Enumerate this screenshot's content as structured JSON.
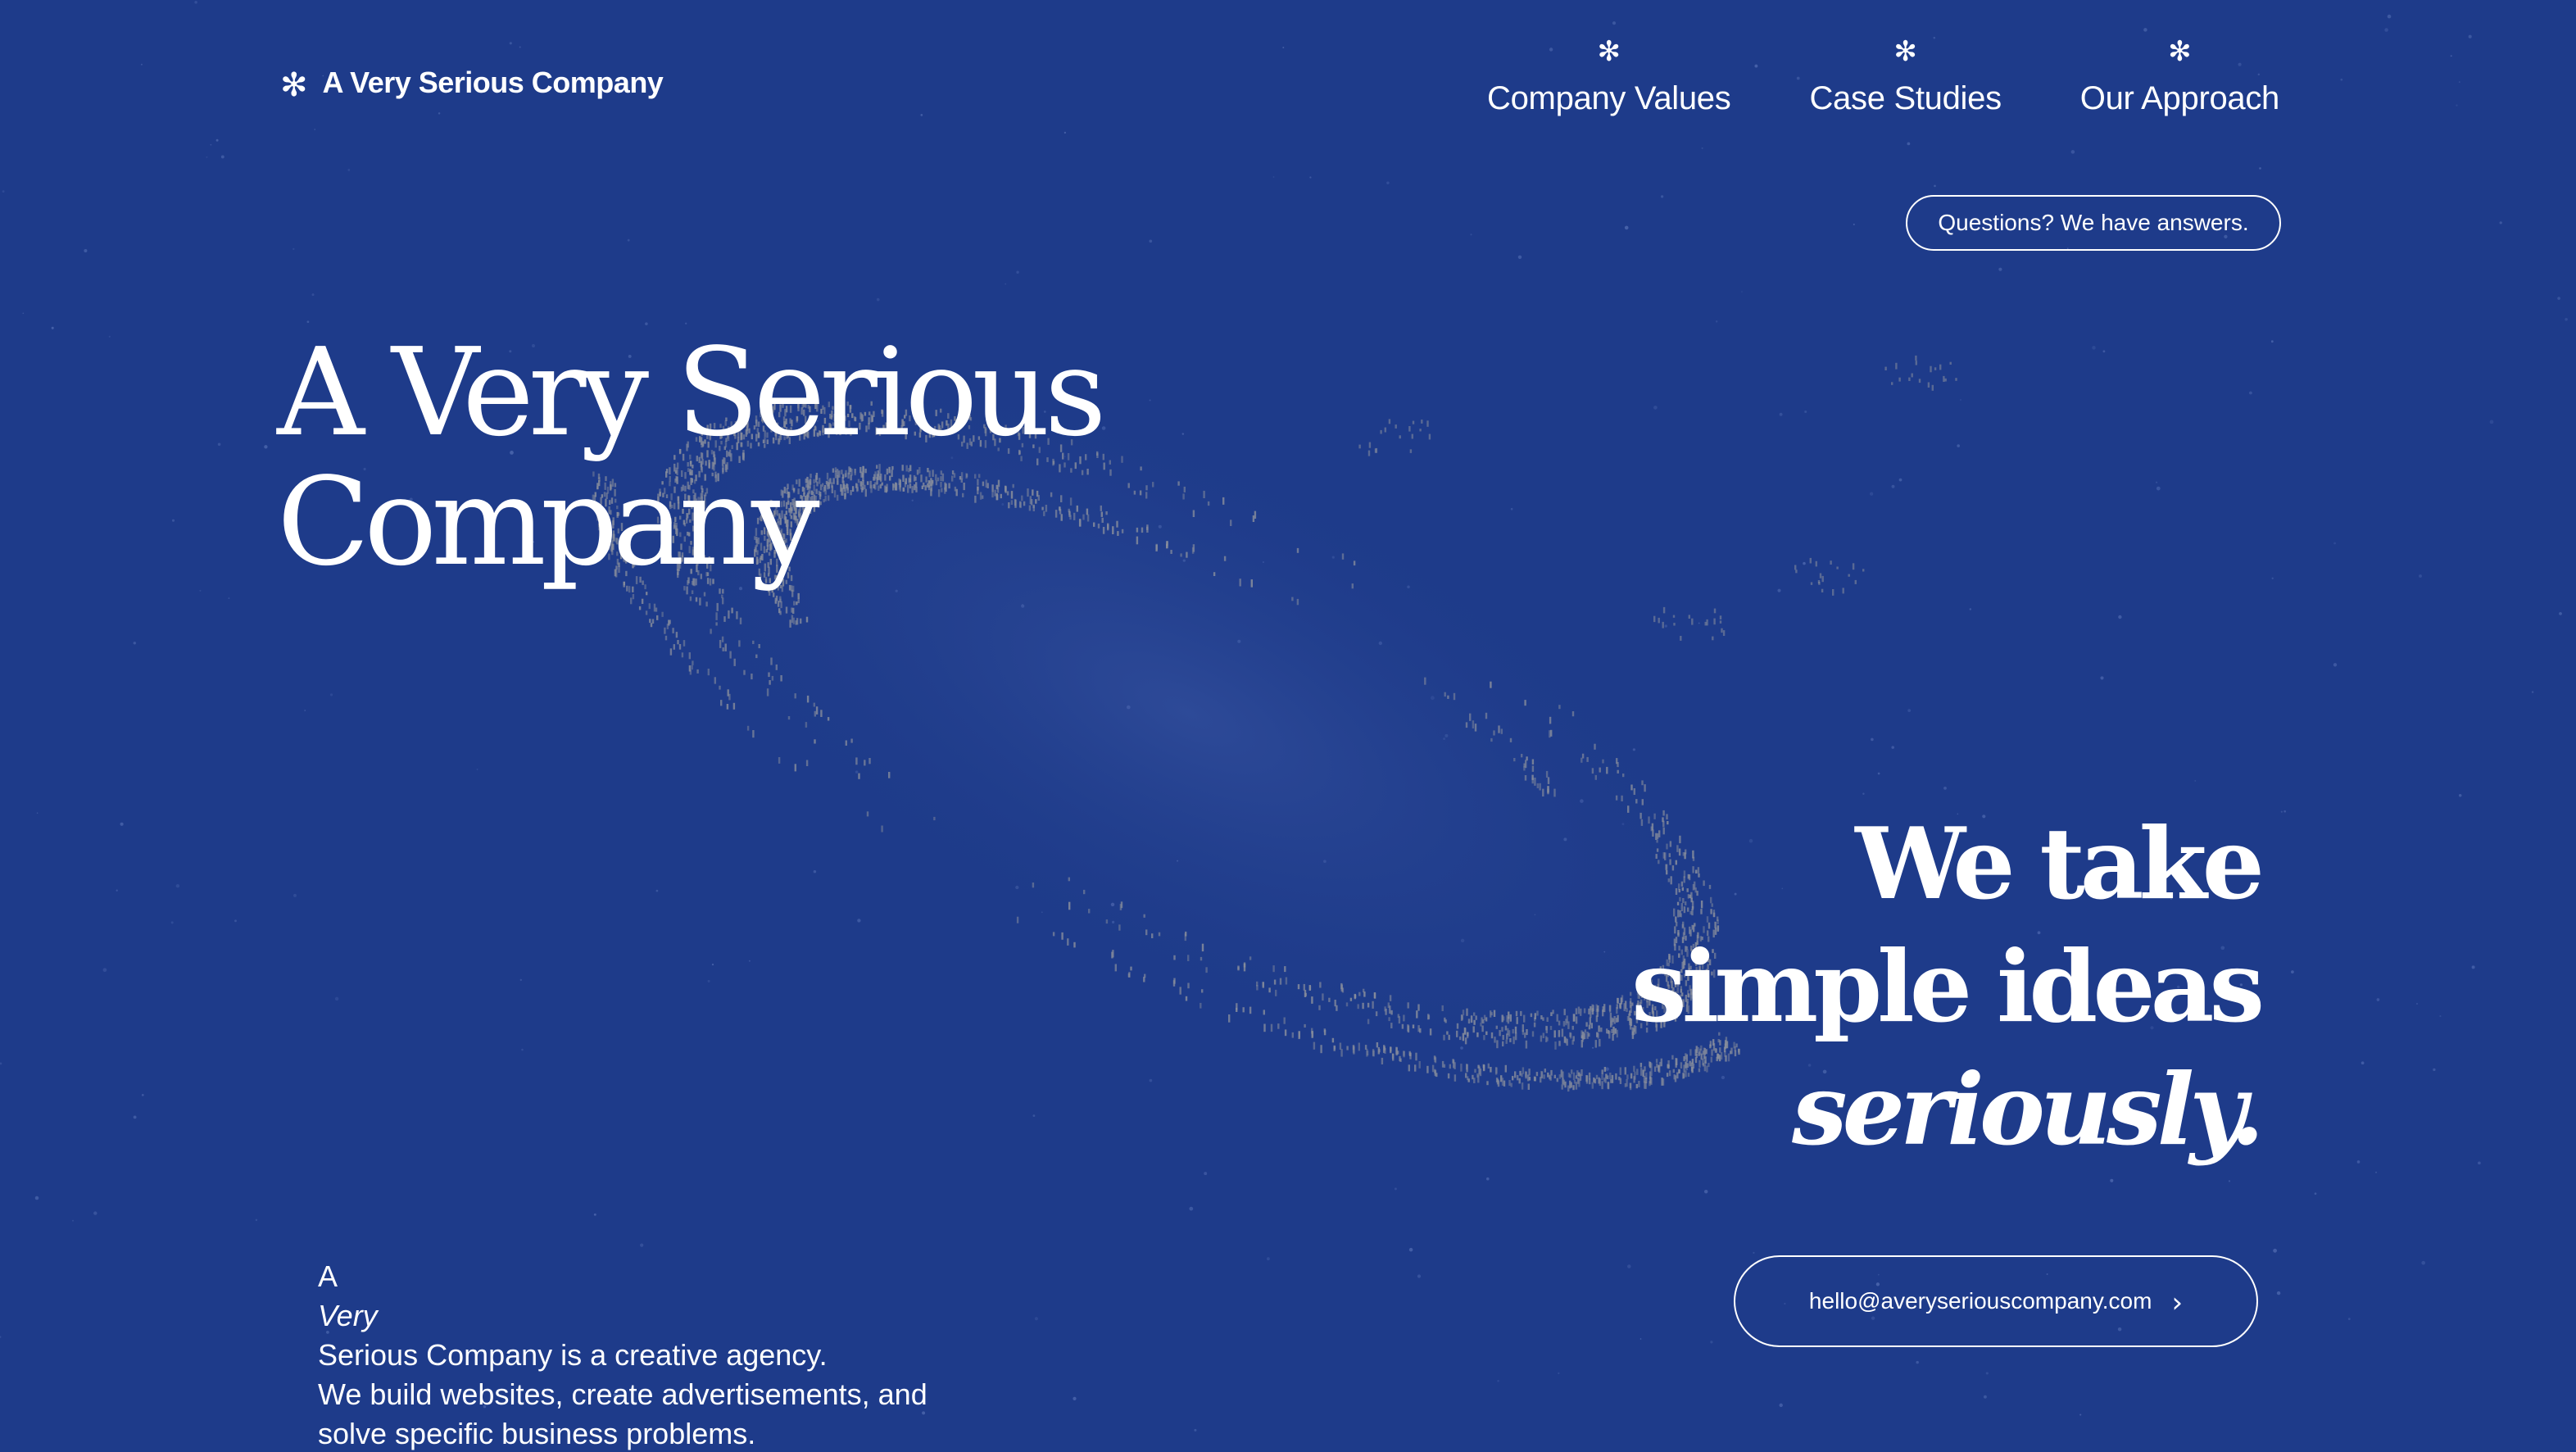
{
  "colors": {
    "background": "#1e3b8a",
    "text": "#ffffff",
    "swirl_dots": "#8a8f9c"
  },
  "logo": {
    "icon": "asterisk-icon",
    "icon_glyph": "✻",
    "name": "A Very Serious Company"
  },
  "nav": {
    "items": [
      {
        "icon": "asterisk-icon",
        "icon_glyph": "✻",
        "label": "Company Values"
      },
      {
        "icon": "asterisk-icon",
        "icon_glyph": "✻",
        "label": "Case Studies"
      },
      {
        "icon": "asterisk-icon",
        "icon_glyph": "✻",
        "label": "Our Approach"
      }
    ]
  },
  "questions_button": {
    "label": "Questions? We have answers."
  },
  "hero": {
    "title_line1": "A Very Serious",
    "title_line2": "Company"
  },
  "tagline": {
    "line1": "We take",
    "line2": "simple ideas",
    "line3": "seriously."
  },
  "description": {
    "line1_prefix": "A ",
    "line1_emphasis": "Very",
    "line1_suffix": " Serious Company is a creative agency.",
    "line2": "We build websites, create advertisements, and",
    "line3": "solve specific business problems."
  },
  "email_button": {
    "label": "hello@averyseriouscompany.com",
    "icon": "chevron-right-icon",
    "icon_glyph": "›"
  }
}
